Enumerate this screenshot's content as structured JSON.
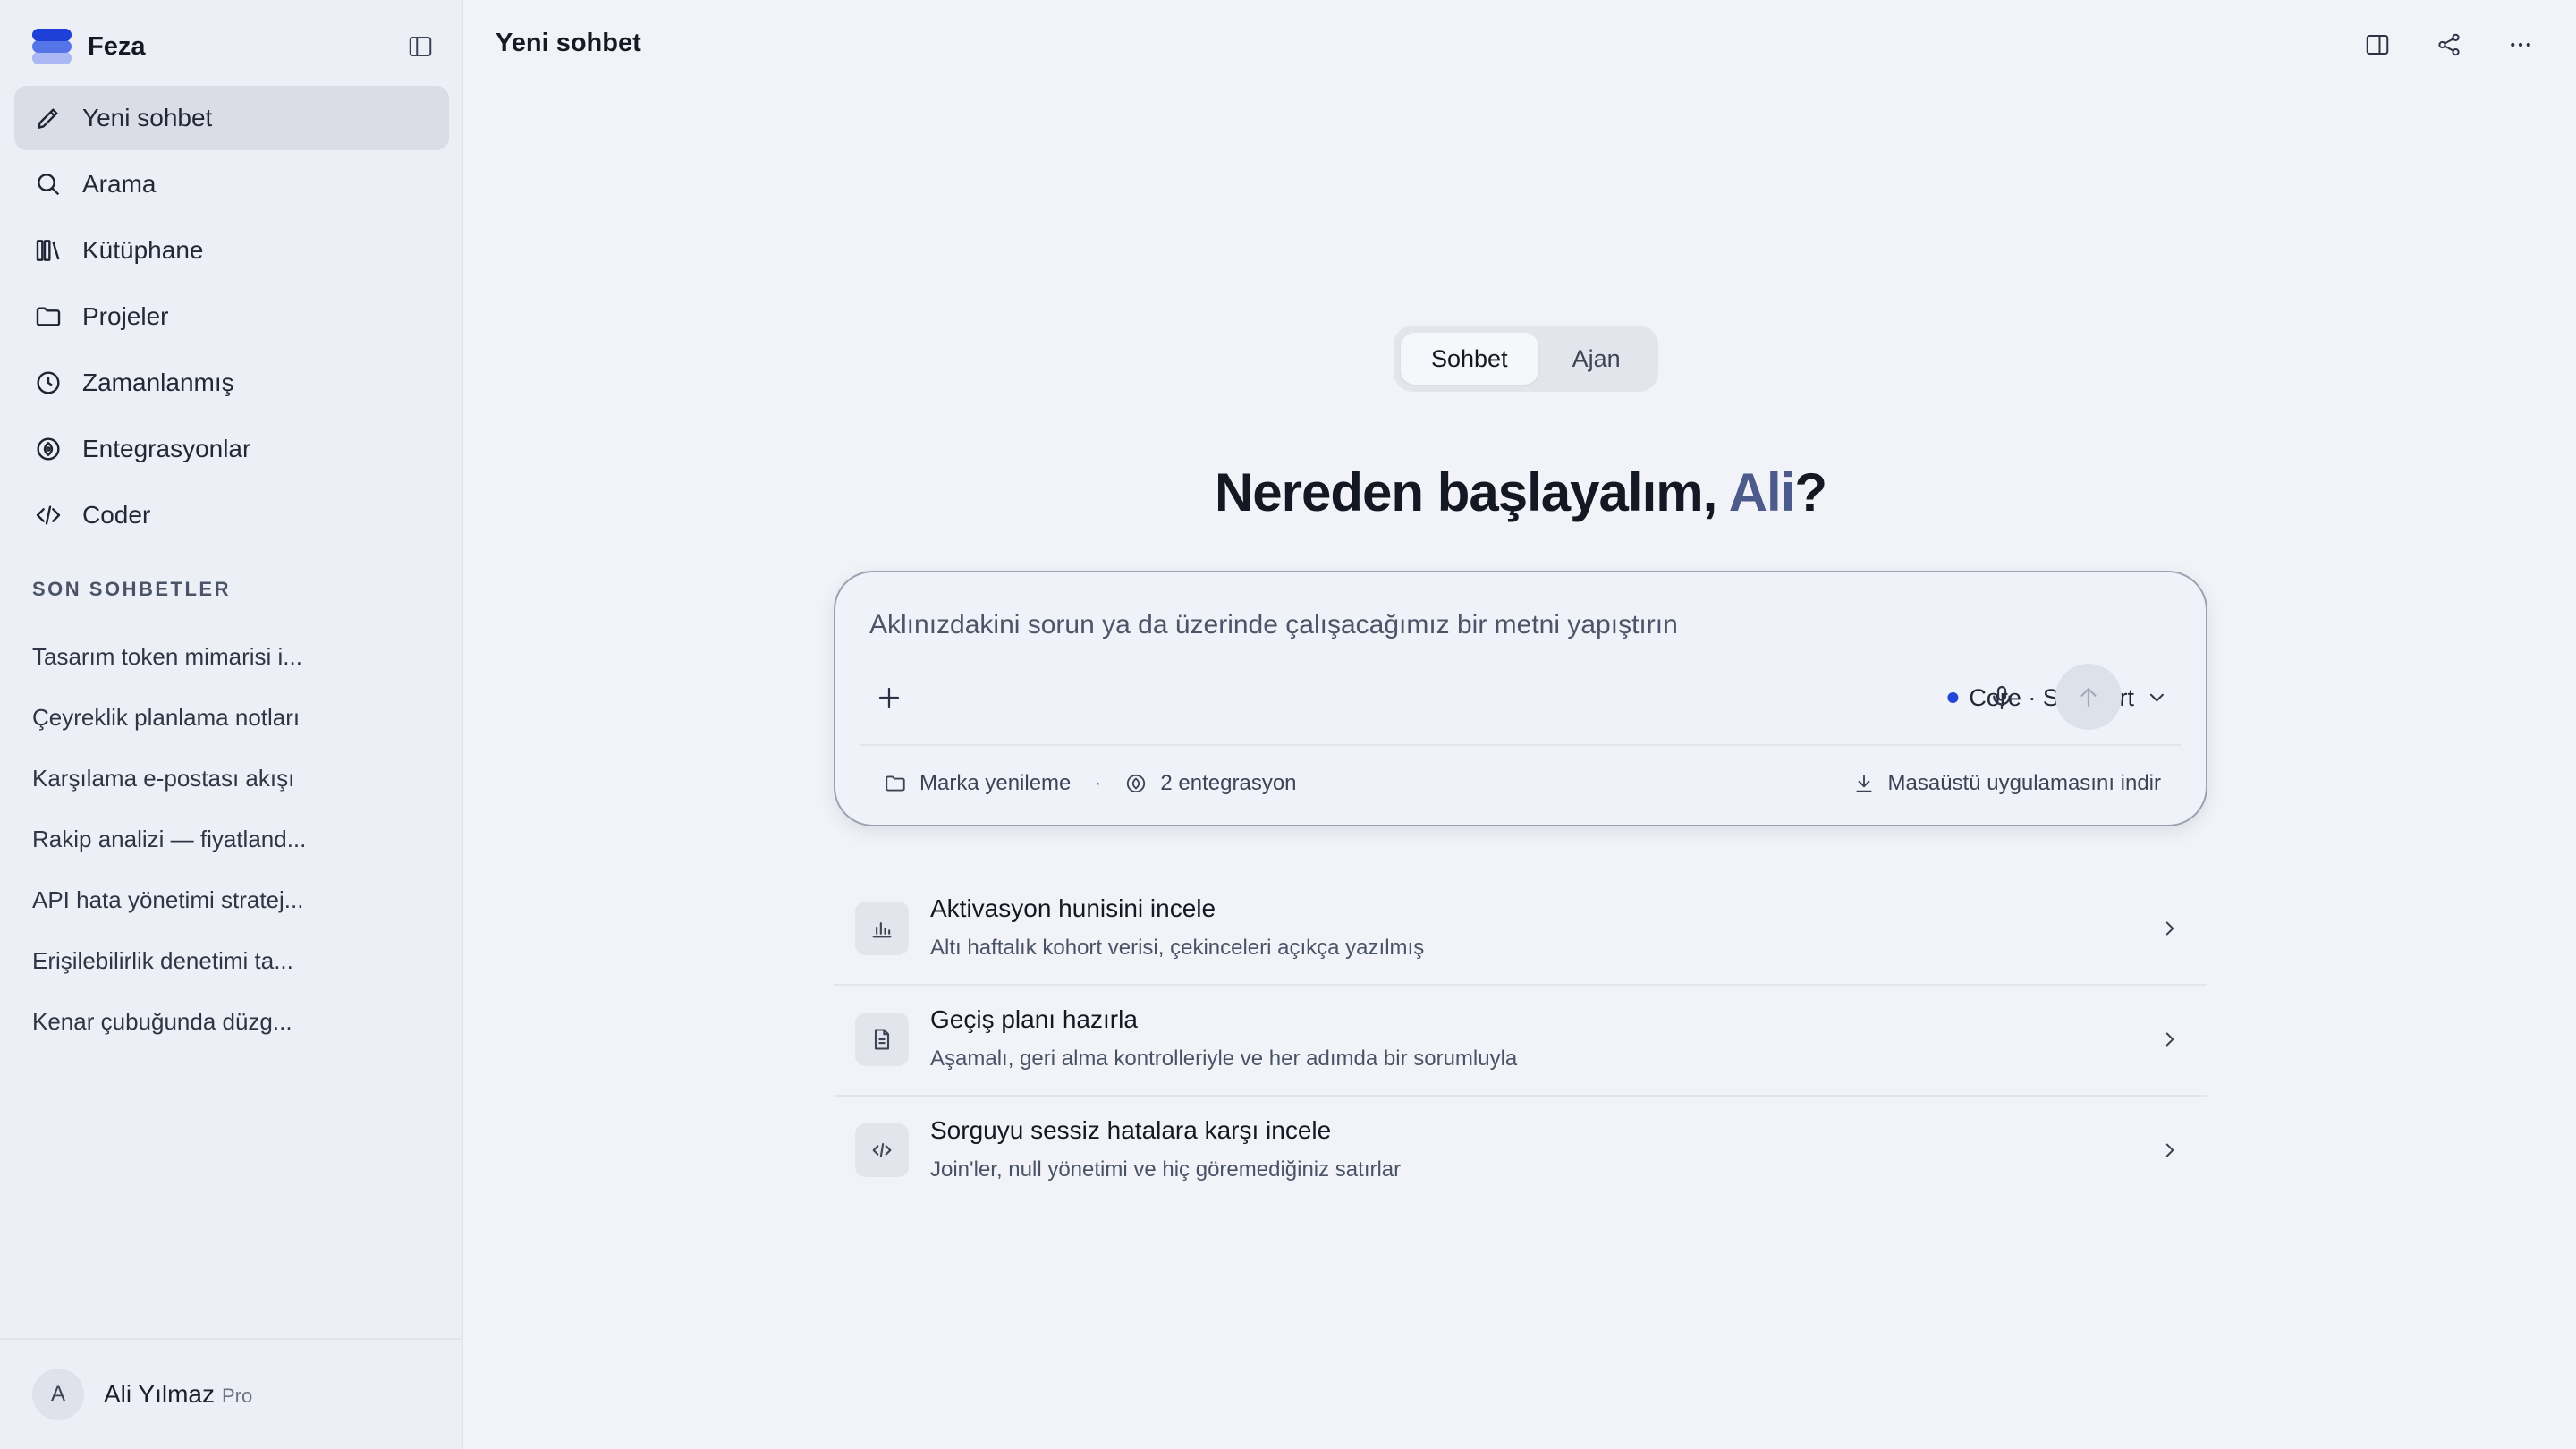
{
  "app": {
    "name": "Feza",
    "brand_color": "#1e3fd8"
  },
  "sidebar": {
    "items": [
      {
        "label": "Yeni sohbet",
        "icon": "pencil-icon",
        "active": true
      },
      {
        "label": "Arama",
        "icon": "search-icon"
      },
      {
        "label": "Kütüphane",
        "icon": "library-icon"
      },
      {
        "label": "Projeler",
        "icon": "folder-icon"
      },
      {
        "label": "Zamanlanmış",
        "icon": "clock-icon"
      },
      {
        "label": "Entegrasyonlar",
        "icon": "integration-icon"
      },
      {
        "label": "Coder",
        "icon": "code-icon"
      }
    ],
    "recent_title": "SON SOHBETLER",
    "recent": [
      "Tasarım token mimarisi i...",
      "Çeyreklik planlama notları",
      "Karşılama e-postası akışı",
      "Rakip analizi — fiyatland...",
      "API hata yönetimi stratej...",
      "Erişilebilirlik denetimi ta...",
      "Kenar çubuğunda düzg..."
    ],
    "user": {
      "initial": "A",
      "name": "Ali Yılmaz",
      "plan": "Pro"
    }
  },
  "main": {
    "title": "Yeni sohbet",
    "modes": [
      {
        "label": "Sohbet",
        "active": true
      },
      {
        "label": "Ajan",
        "active": false
      }
    ],
    "greeting": {
      "prefix": "Nereden başlayalım, ",
      "name": "Ali",
      "suffix": "?"
    },
    "composer": {
      "placeholder": "Aklınızdakini sorun ya da üzerinde çalışacağımız bir metni yapıştırın",
      "value": "",
      "model": "Core · Standart",
      "project": "Marka yenileme",
      "separator": "·",
      "integrations": "2 entegrasyon",
      "download": "Masaüstü uygulamasını indir"
    },
    "suggestions": [
      {
        "title": "Aktivasyon hunisini incele",
        "desc": "Altı haftalık kohort verisi, çekinceleri açıkça yazılmış",
        "icon": "bar-chart-icon"
      },
      {
        "title": "Geçiş planı hazırla",
        "desc": "Aşamalı, geri alma kontrolleriyle ve her adımda bir sorumluyla",
        "icon": "document-icon"
      },
      {
        "title": "Sorguyu sessiz hatalara karşı incele",
        "desc": "Join'ler, null yönetimi ve hiç göremediğiniz satırlar",
        "icon": "code-icon"
      }
    ]
  }
}
